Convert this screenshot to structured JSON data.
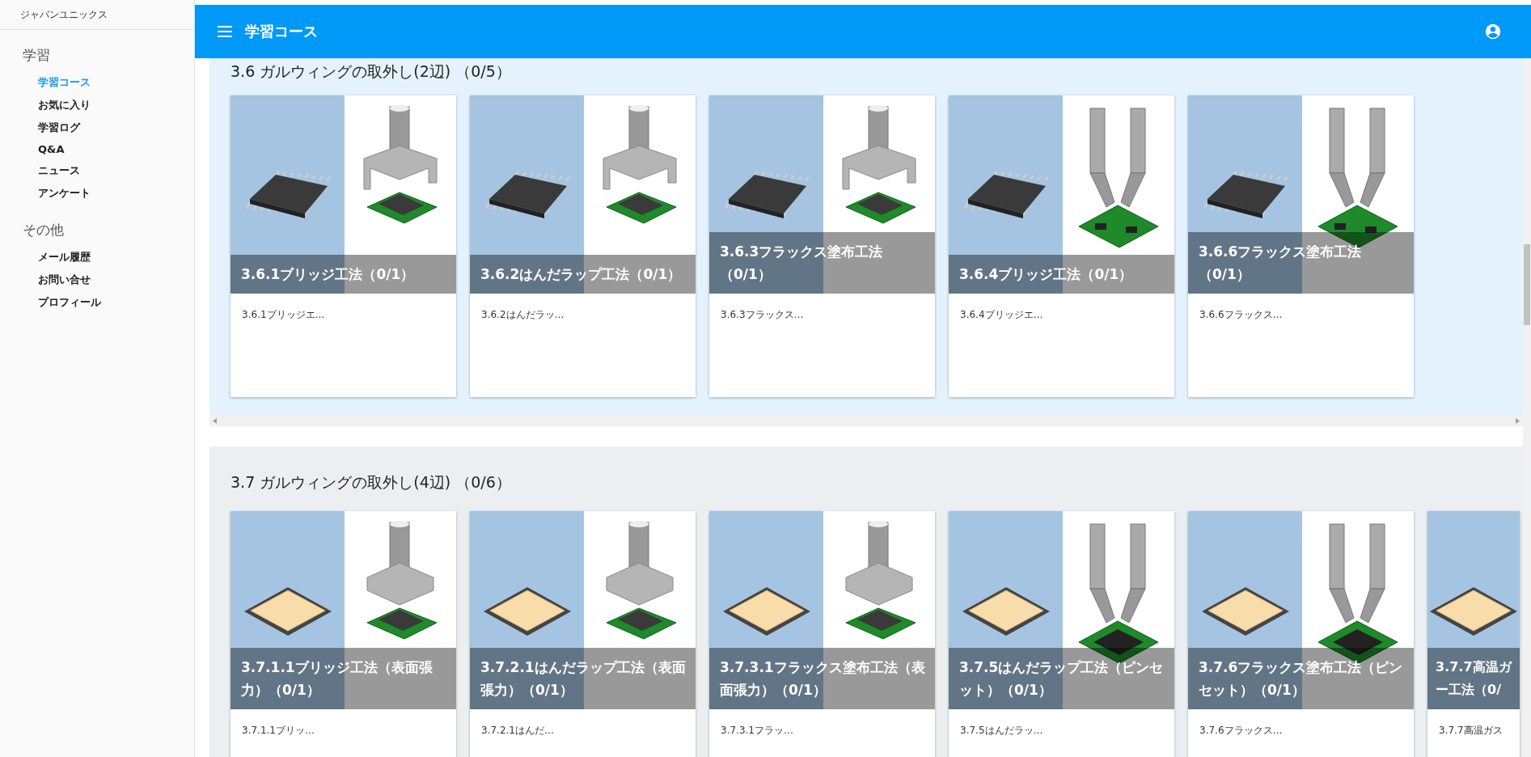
{
  "sidebar": {
    "brand": "ジャパンユニックス",
    "groups": [
      {
        "title": "学習",
        "items": [
          {
            "label": "学習コース",
            "selected": true
          },
          {
            "label": "お気に入り",
            "selected": false
          },
          {
            "label": "学習ログ",
            "selected": false
          },
          {
            "label": "Q&A",
            "selected": false
          },
          {
            "label": "ニュース",
            "selected": false
          },
          {
            "label": "アンケート",
            "selected": false
          }
        ]
      },
      {
        "title": "その他",
        "items": [
          {
            "label": "メール履歴",
            "selected": false
          },
          {
            "label": "お問い合せ",
            "selected": false
          },
          {
            "label": "プロフィール",
            "selected": false
          }
        ]
      }
    ]
  },
  "header": {
    "title": "学習コース"
  },
  "sections": [
    {
      "title": "3.6 ガルウィングの取外し(2辺) （0/5）",
      "kind": "sop",
      "cards": [
        {
          "title": "3.6.1ブリッジ工法（0/1）",
          "caption": "3.6.1ブリッジエ…",
          "kind": "nozzle"
        },
        {
          "title": "3.6.2はんだラップ工法（0/1）",
          "caption": "3.6.2はんだラッ…",
          "kind": "nozzle"
        },
        {
          "title": "3.6.3フラックス塗布工法（0/1）",
          "caption": "3.6.3フラックス…",
          "kind": "nozzle"
        },
        {
          "title": "3.6.4ブリッジ工法（0/1）",
          "caption": "3.6.4ブリッジエ…",
          "kind": "tweezers"
        },
        {
          "title": "3.6.6フラックス塗布工法（0/1）",
          "caption": "3.6.6フラックス…",
          "kind": "tweezers"
        }
      ]
    },
    {
      "title": "3.7 ガルウィングの取外し(4辺) （0/6）",
      "kind": "qfp",
      "cards": [
        {
          "title": "3.7.1.1ブリッジ工法（表面張力）（0/1）",
          "caption": "3.7.1.1ブリッ…",
          "kind": "nozzle"
        },
        {
          "title": "3.7.2.1はんだラップ工法（表面張力）（0/1）",
          "caption": "3.7.2.1はんだ…",
          "kind": "nozzle"
        },
        {
          "title": "3.7.3.1フラックス塗布工法（表面張力）（0/1）",
          "caption": "3.7.3.1フラッ…",
          "kind": "nozzle"
        },
        {
          "title": "3.7.5はんだラップ工法（ピンセット）（0/1）",
          "caption": "3.7.5はんだラッ…",
          "kind": "tweezers"
        },
        {
          "title": "3.7.6フラックス塗布工法（ピンセット）（0/1）",
          "caption": "3.7.6フラックス…",
          "kind": "tweezers"
        },
        {
          "title": "3.7.7高温ガー工法（0/",
          "caption": "3.7.7高温ガス",
          "kind": "partial"
        }
      ]
    }
  ]
}
